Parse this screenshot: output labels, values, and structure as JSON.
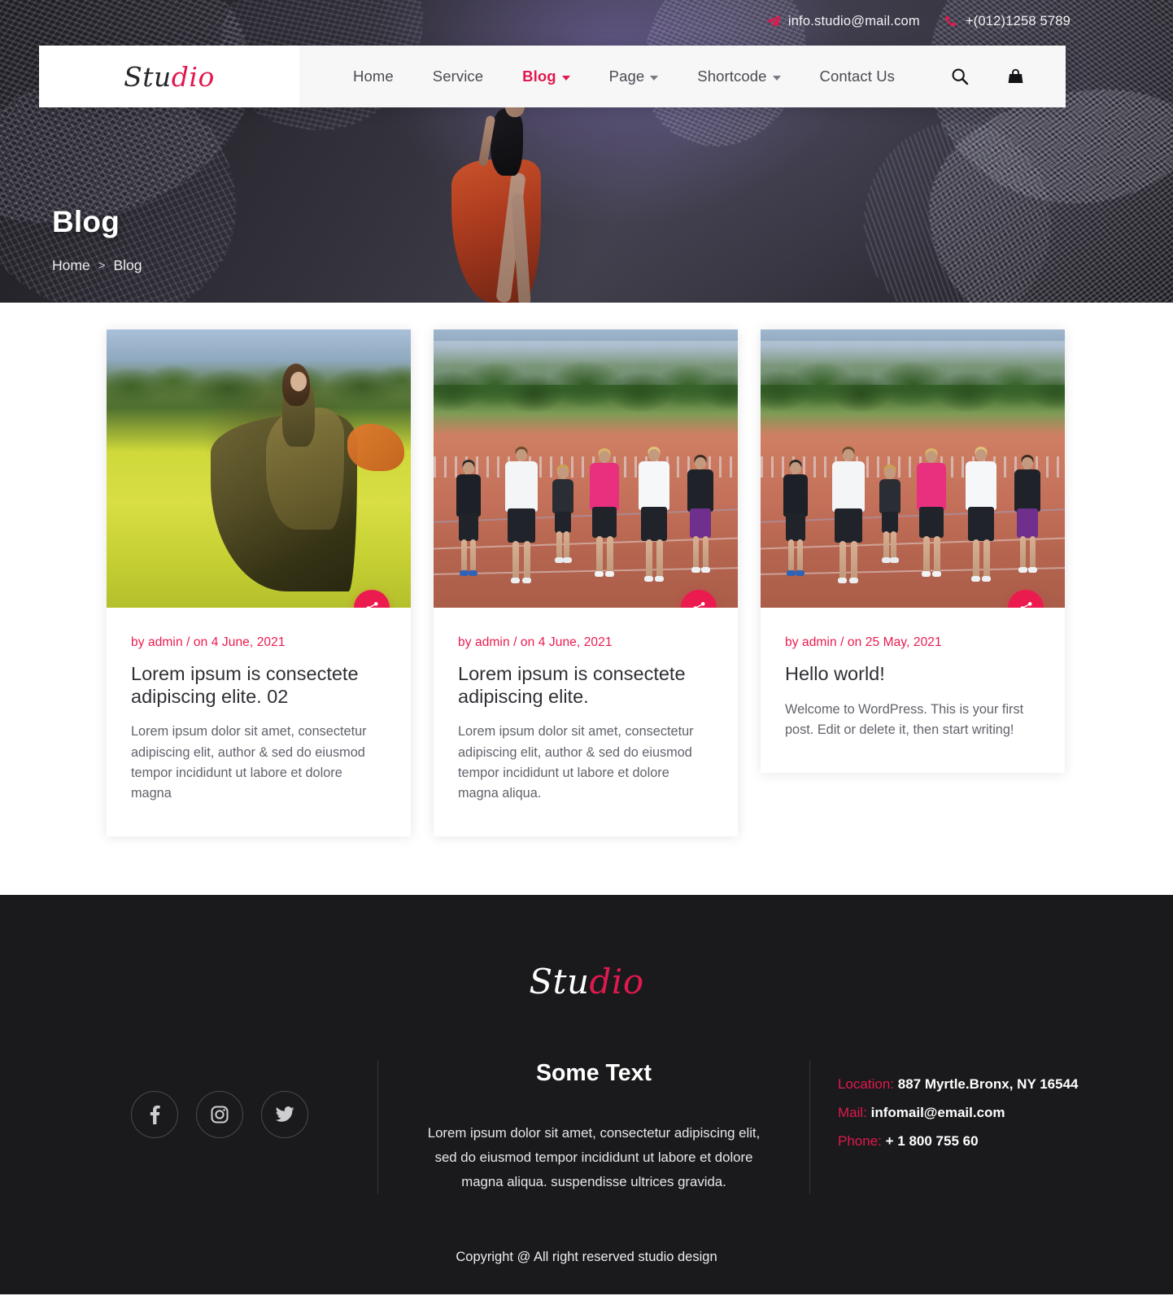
{
  "topbar": {
    "email": "info.studio@mail.com",
    "phone": "+(012)1258 5789",
    "email_icon": "send-icon",
    "phone_icon": "phone-icon"
  },
  "brand": {
    "part1": "Stu",
    "part2": "dio"
  },
  "nav": {
    "items": [
      {
        "label": "Home",
        "has_caret": false,
        "active": false
      },
      {
        "label": "Service",
        "has_caret": false,
        "active": false
      },
      {
        "label": "Blog",
        "has_caret": true,
        "active": true
      },
      {
        "label": "Page",
        "has_caret": true,
        "active": false
      },
      {
        "label": "Shortcode",
        "has_caret": true,
        "active": false
      },
      {
        "label": "Contact Us",
        "has_caret": false,
        "active": false
      }
    ],
    "search_icon": "search-icon",
    "cart_icon": "shopping-bag-icon"
  },
  "hero": {
    "title": "Blog",
    "breadcrumb": {
      "home": "Home",
      "separator": ">",
      "current": "Blog"
    }
  },
  "posts": [
    {
      "meta": "by admin / on 4 June, 2021",
      "title": "Lorem ipsum is consectete adipiscing elite. 02",
      "excerpt": "Lorem ipsum dolor sit amet, consectetur adipiscing elit, author & sed do eiusmod tempor incididunt ut labore et dolore magna",
      "share_icon": "share-icon",
      "image_alt": "woman-in-yellow-flower-field"
    },
    {
      "meta": "by admin / on 4 June, 2021",
      "title": "Lorem ipsum is consectete adipiscing elite.",
      "excerpt": "Lorem ipsum dolor sit amet, consectetur adipiscing elit, author & sed do eiusmod tempor incididunt ut labore et dolore magna aliqua.",
      "share_icon": "share-icon",
      "image_alt": "group-running-on-track"
    },
    {
      "meta": "by admin / on 25 May, 2021",
      "title": "Hello world!",
      "excerpt": "Welcome to WordPress. This is your first post. Edit or delete it, then start writing!",
      "share_icon": "share-icon",
      "image_alt": "group-running-on-track"
    }
  ],
  "footer": {
    "logo": {
      "part1": "Stu",
      "part2": "dio"
    },
    "social": [
      {
        "name": "facebook-icon",
        "label": "Facebook"
      },
      {
        "name": "instagram-icon",
        "label": "Instagram"
      },
      {
        "name": "twitter-icon",
        "label": "Twitter"
      }
    ],
    "middle": {
      "title": "Some Text",
      "text": "Lorem ipsum dolor sit amet, consectetur adipiscing elit, sed do eiusmod tempor incididunt ut labore et dolore magna aliqua. suspendisse ultrices gravida."
    },
    "contact": {
      "location_label": "Location:",
      "location_value": "887 Myrtle.Bronx, NY 16544",
      "mail_label": "Mail:",
      "mail_value": "infomail@email.com",
      "phone_label": "Phone:",
      "phone_value": "+ 1 800 755 60"
    },
    "copyright": "Copyright @ All right reserved studio design"
  },
  "colors": {
    "accent": "#e0194e",
    "share": "#ec1b4f",
    "footer_bg": "#1a1a1c",
    "hero_bg": "#232228"
  }
}
